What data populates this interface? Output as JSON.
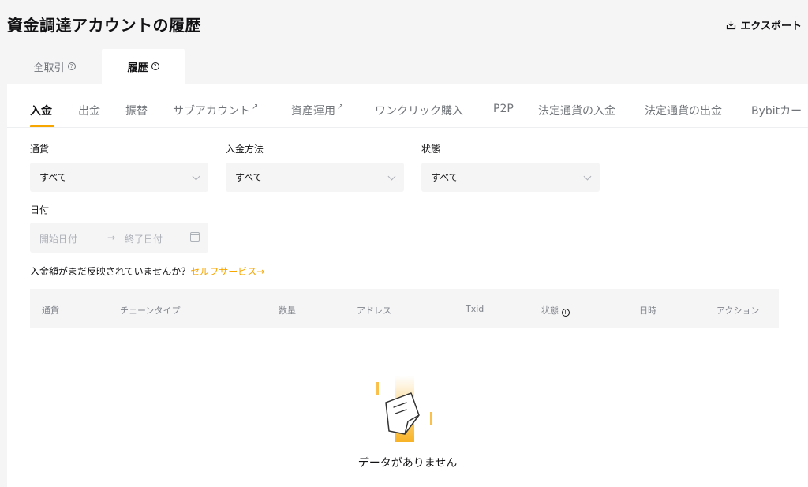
{
  "page": {
    "title": "資金調達アカウントの履歴",
    "export_label": "エクスポート"
  },
  "top_tabs": [
    {
      "label": "全取引",
      "active": false
    },
    {
      "label": "履歴",
      "active": true
    }
  ],
  "sub_tabs": [
    {
      "label": "入金",
      "active": true
    },
    {
      "label": "出金"
    },
    {
      "label": "振替"
    },
    {
      "label": "サブアカウント",
      "external": true
    },
    {
      "label": "資産運用",
      "external": true
    },
    {
      "label": "ワンクリック購入"
    },
    {
      "label": "P2P"
    },
    {
      "label": "法定通貨の入金"
    },
    {
      "label": "法定通貨の出金"
    },
    {
      "label": "Bybitカー"
    }
  ],
  "external_mark": "↗",
  "filters": {
    "currency": {
      "label": "通貨",
      "value": "すべて"
    },
    "method": {
      "label": "入金方法",
      "value": "すべて"
    },
    "status": {
      "label": "状態",
      "value": "すべて"
    },
    "date": {
      "label": "日付",
      "start_placeholder": "開始日付",
      "separator": "→",
      "end_placeholder": "終了日付"
    }
  },
  "notice": {
    "text": "入金額がまだ反映されていませんか？",
    "link": "セルフサービス→"
  },
  "table": {
    "columns": [
      "通貨",
      "チェーンタイプ",
      "数量",
      "アドレス",
      "Txid",
      "状態",
      "日時",
      "アクション"
    ]
  },
  "empty_state": {
    "text": "データがありません"
  },
  "colors": {
    "accent": "#f7a600",
    "background": "#f5f5f6",
    "panel": "#ffffff",
    "text_primary": "#121214",
    "text_secondary": "#71757a"
  }
}
